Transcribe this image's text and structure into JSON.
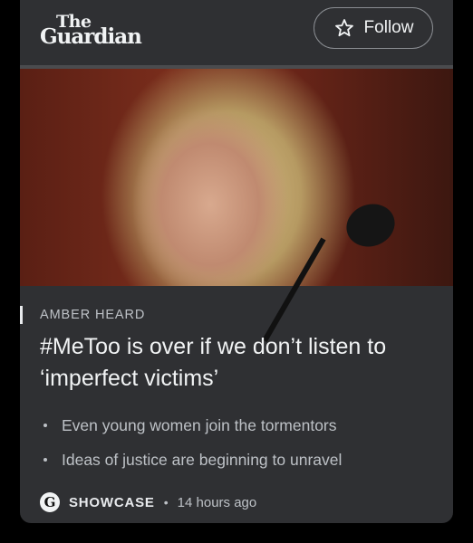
{
  "publisher": {
    "logo_line1": "The",
    "logo_line2": "Guardian",
    "follow_label": "Follow"
  },
  "article": {
    "tag": "AMBER HEARD",
    "headline": "#MeToo is over if we don’t listen to ‘imperfect victims’",
    "bullets": [
      "Even young women join the tormentors",
      "Ideas of justice are beginning to unravel"
    ],
    "source_badge": "G",
    "source_label": "SHOWCASE",
    "separator": "•",
    "time": "14 hours ago"
  },
  "icons": {
    "follow": "star-outline-icon",
    "hero": "article-photo",
    "source": "guardian-g-icon"
  }
}
